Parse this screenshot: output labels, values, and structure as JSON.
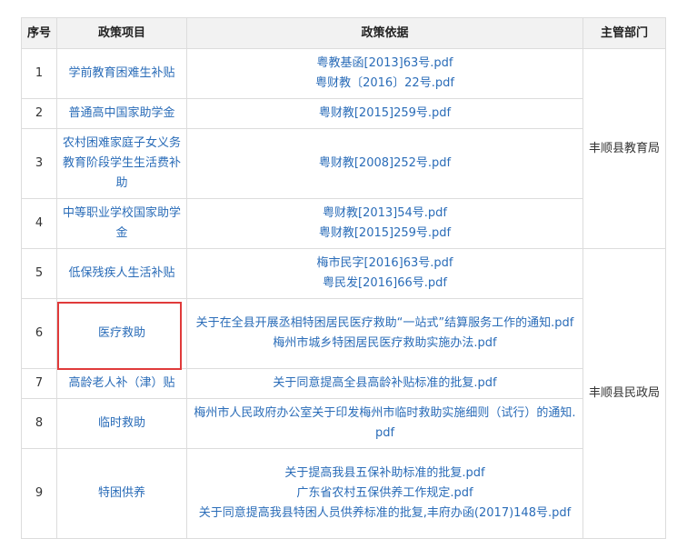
{
  "headers": {
    "index": "序号",
    "item": "政策项目",
    "basis": "政策依据",
    "dept": "主管部门"
  },
  "rows": [
    {
      "index": "1",
      "item": "学前教育困难生补贴",
      "files": [
        "粤教基函[2013]63号.pdf",
        "粤财教〔2016〕22号.pdf"
      ]
    },
    {
      "index": "2",
      "item": "普通高中国家助学金",
      "files": [
        "粤财教[2015]259号.pdf"
      ]
    },
    {
      "index": "3",
      "item": "农村困难家庭子女义务教育阶段学生生活费补助",
      "files": [
        "粤财教[2008]252号.pdf"
      ]
    },
    {
      "index": "4",
      "item": "中等职业学校国家助学金",
      "files": [
        "粤财教[2013]54号.pdf",
        "粤财教[2015]259号.pdf"
      ]
    },
    {
      "index": "5",
      "item": "低保残疾人生活补贴",
      "files": [
        "梅市民字[2016]63号.pdf",
        "粤民发[2016]66号.pdf"
      ]
    },
    {
      "index": "6",
      "item": "医疗救助",
      "files": [
        "关于在全县开展丞相特困居民医疗救助“一站式”结算服务工作的通知.pdf",
        "梅州市城乡特困居民医疗救助实施办法.pdf"
      ]
    },
    {
      "index": "7",
      "item": "高龄老人补（津）贴",
      "files": [
        "关于同意提高全县高龄补贴标准的批复.pdf"
      ]
    },
    {
      "index": "8",
      "item": "临时救助",
      "files": [
        "梅州市人民政府办公室关于印发梅州市临时救助实施细则（试行）的通知.pdf"
      ]
    },
    {
      "index": "9",
      "item": "特困供养",
      "files": [
        "关于提高我县五保补助标准的批复.pdf",
        "广东省农村五保供养工作规定.pdf",
        "关于同意提高我县特困人员供养标准的批复,丰府办函(2017)148号.pdf"
      ]
    }
  ],
  "departments": {
    "education": "丰顺县教育局",
    "civil_affairs": "丰顺县民政局"
  }
}
